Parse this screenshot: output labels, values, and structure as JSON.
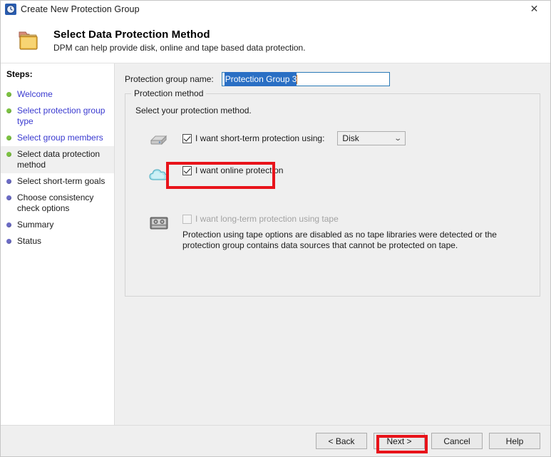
{
  "window": {
    "title": "Create New Protection Group",
    "app_icon": "clock-recovery-icon",
    "close_label": "✕"
  },
  "header": {
    "icon": "folder-icon",
    "title": "Select Data Protection Method",
    "subtitle": "DPM can help provide disk, online and tape based data protection."
  },
  "sidebar": {
    "heading": "Steps:",
    "items": [
      {
        "label": "Welcome",
        "state": "done"
      },
      {
        "label": "Select protection group type",
        "state": "done"
      },
      {
        "label": "Select group members",
        "state": "done"
      },
      {
        "label": "Select data protection method",
        "state": "current"
      },
      {
        "label": "Select short-term goals",
        "state": "todo"
      },
      {
        "label": "Choose consistency check options",
        "state": "todo"
      },
      {
        "label": "Summary",
        "state": "todo"
      },
      {
        "label": "Status",
        "state": "todo"
      }
    ]
  },
  "main": {
    "name_label": "Protection group name:",
    "name_value": "Protection Group 3",
    "groupbox_title": "Protection method",
    "groupbox_intro": "Select your protection method.",
    "options": [
      {
        "icon": "disk-icon",
        "label": "I want short-term protection using:",
        "checked": true,
        "disabled": false,
        "combo_value": "Disk",
        "combo_chevron": "⌄"
      },
      {
        "icon": "cloud-icon",
        "label": "I want online protection",
        "checked": true,
        "disabled": false
      },
      {
        "icon": "tape-icon",
        "label": "I want long-term protection using tape",
        "checked": false,
        "disabled": true,
        "note": "Protection using tape options are disabled as no tape libraries were detected or the protection group contains data sources that cannot be protected on tape."
      }
    ]
  },
  "footer": {
    "back": "< Back",
    "next": "Next >",
    "cancel": "Cancel",
    "help": "Help"
  },
  "annotations": {
    "highlight_color": "#e8131a",
    "highlighted": [
      "I want online protection",
      "Next >"
    ]
  }
}
